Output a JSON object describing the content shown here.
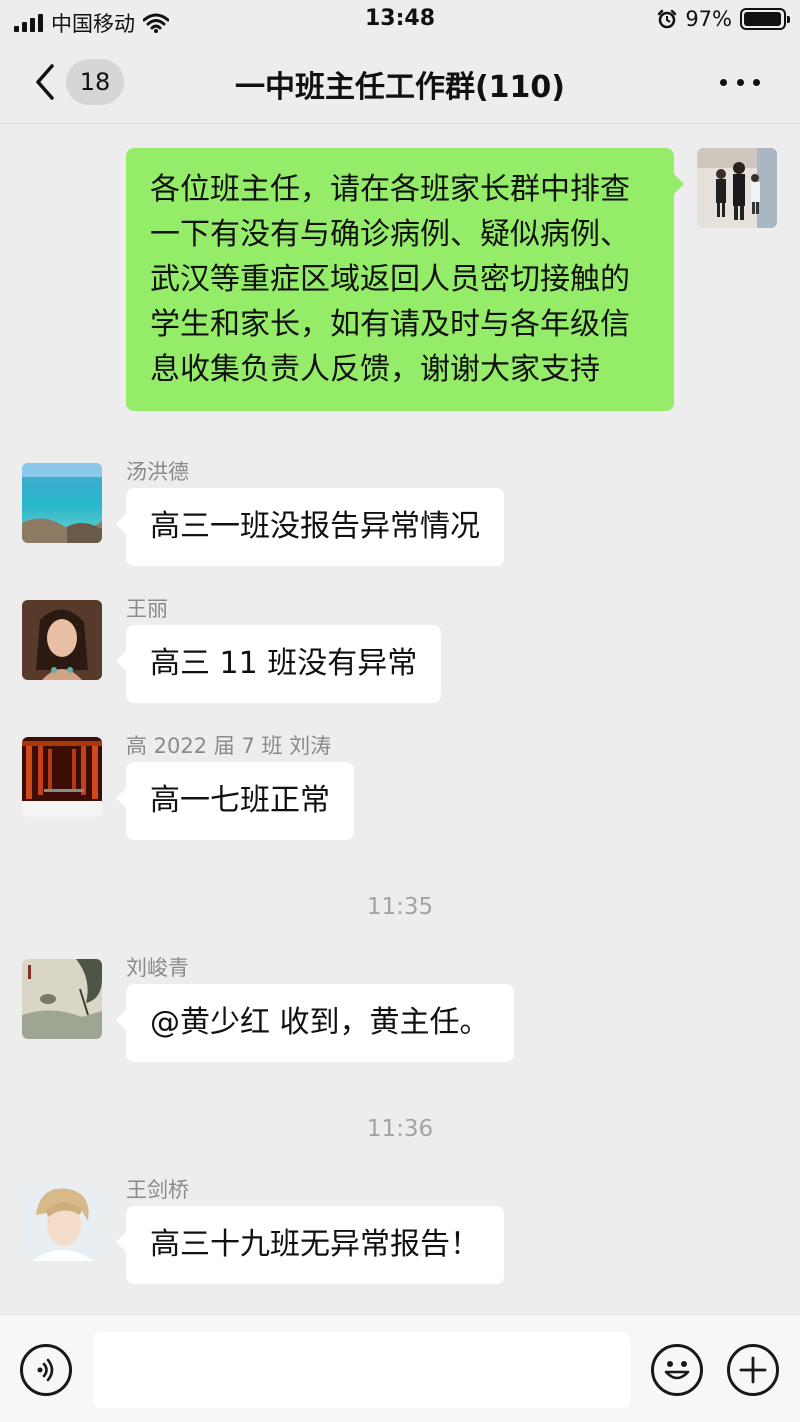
{
  "status_bar": {
    "carrier": "中国移动",
    "time": "13:48",
    "battery": "97%",
    "battery_level": 0.97,
    "icons": [
      "signal-icon",
      "wifi-icon",
      "alarm-icon",
      "battery-icon"
    ]
  },
  "nav": {
    "unread_count": "18",
    "title": "一中班主任工作群(110)",
    "icons": [
      "chevron-left-icon",
      "more-icon"
    ]
  },
  "messages": [
    {
      "sender": "",
      "text": "各位班主任，请在各班家长群中排查一下有没有与确诊病例、疑似病例、武汉等重症区域返回人员密切接触的学生和家长，如有请及时与各年级信息收集负责人反馈，谢谢大家支持",
      "self": true
    },
    {
      "sender": "汤洪德",
      "text": "高三一班没报告异常情况"
    },
    {
      "sender": "王丽",
      "text": "高三 11 班没有异常"
    },
    {
      "sender": "高 2022 届 7 班  刘涛",
      "text": "高一七班正常"
    },
    {
      "sender": "刘峻青",
      "text": "@黄少红 收到，黄主任。"
    },
    {
      "sender": "王剑桥",
      "text": "高三十九班无异常报告！"
    }
  ],
  "time_separators": [
    "11:35",
    "11:36"
  ],
  "input_bar": {
    "value": "",
    "icons": [
      "voice-icon",
      "emoji-icon",
      "plus-icon"
    ]
  },
  "colors": {
    "background": "#ededed",
    "self_bubble": "#95ec69",
    "other_bubble": "#ffffff",
    "meta_text": "#8a8a8a"
  }
}
